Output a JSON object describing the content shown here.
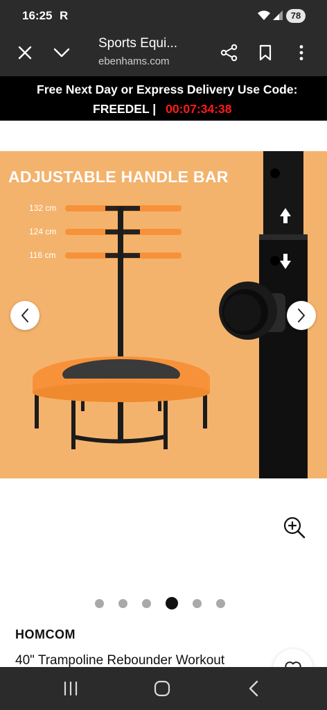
{
  "status": {
    "time": "16:25",
    "carrier_indicator": "R",
    "battery": "78"
  },
  "browser": {
    "page_title": "Sports Equi...",
    "url": "ebenhams.com",
    "icons": [
      "close-icon",
      "chevron-down-icon",
      "share-icon",
      "bookmark-icon",
      "more-vert-icon"
    ]
  },
  "promo": {
    "line1": "Free Next Day or Express Delivery Use Code:",
    "code": "FREEDEL |",
    "timer": "00:07:34:38",
    "timer_color": "#ff1a1a"
  },
  "gallery": {
    "heading": "ADJUSTABLE HANDLE BAR",
    "heights": [
      "132 cm",
      "124 cm",
      "116 cm"
    ],
    "background_color": "#f4b36c",
    "accent_orange": "#f7923a",
    "image_count": 6,
    "active_index": 3
  },
  "product": {
    "brand": "HOMCOM",
    "title": "40\" Trampoline Rebounder Workout"
  }
}
